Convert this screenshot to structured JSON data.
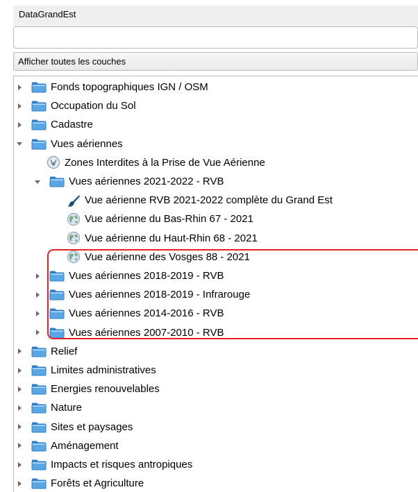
{
  "panel": {
    "title": "DataGrandEst",
    "search_value": "",
    "filter_label": "Afficher toutes les couches"
  },
  "tree": {
    "items": [
      {
        "label": "Fonds topographiques IGN / OSM",
        "level": 0,
        "kind": "folder",
        "expanded": false
      },
      {
        "label": "Occupation du Sol",
        "level": 0,
        "kind": "folder",
        "expanded": false
      },
      {
        "label": "Cadastre",
        "level": 0,
        "kind": "folder",
        "expanded": false
      },
      {
        "label": "Vues aériennes",
        "level": 0,
        "kind": "folder",
        "expanded": true
      },
      {
        "label": "Zones Interdites à la Prise de Vue Aérienne",
        "level": 1,
        "kind": "wfs-icon"
      },
      {
        "label": "Vues aériennes 2021-2022 - RVB",
        "level": 1,
        "kind": "folder",
        "expanded": true
      },
      {
        "label": "Vue aérienne RVB 2021-2022 complète du Grand Est",
        "level": 2,
        "kind": "brush-icon"
      },
      {
        "label": "Vue aérienne du Bas-Rhin 67 - 2021",
        "level": 2,
        "kind": "globe-icon"
      },
      {
        "label": "Vue aérienne du Haut-Rhin 68 - 2021",
        "level": 2,
        "kind": "globe-icon"
      },
      {
        "label": "Vue aérienne des Vosges 88 - 2021",
        "level": 2,
        "kind": "globe-icon"
      },
      {
        "label": "Vues aériennes 2018-2019 - RVB",
        "level": 1,
        "kind": "folder",
        "expanded": false
      },
      {
        "label": "Vues aériennes 2018-2019 - Infrarouge",
        "level": 1,
        "kind": "folder",
        "expanded": false
      },
      {
        "label": "Vues aériennes 2014-2016 - RVB",
        "level": 1,
        "kind": "folder",
        "expanded": false
      },
      {
        "label": "Vues aériennes 2007-2010 - RVB",
        "level": 1,
        "kind": "folder",
        "expanded": false
      },
      {
        "label": "Relief",
        "level": 0,
        "kind": "folder",
        "expanded": false
      },
      {
        "label": "Limites administratives",
        "level": 0,
        "kind": "folder",
        "expanded": false
      },
      {
        "label": "Energies renouvelables",
        "level": 0,
        "kind": "folder",
        "expanded": false
      },
      {
        "label": "Nature",
        "level": 0,
        "kind": "folder",
        "expanded": false
      },
      {
        "label": "Sites et paysages",
        "level": 0,
        "kind": "folder",
        "expanded": false
      },
      {
        "label": "Aménagement",
        "level": 0,
        "kind": "folder",
        "expanded": false
      },
      {
        "label": "Impacts et risques antropiques",
        "level": 0,
        "kind": "folder",
        "expanded": false
      },
      {
        "label": "Forêts et Agriculture",
        "level": 0,
        "kind": "folder",
        "expanded": false
      }
    ]
  },
  "colors": {
    "folder_fill": "#5aa7e6",
    "folder_tab": "#2f7fc8",
    "highlight_border": "#e8212b"
  }
}
